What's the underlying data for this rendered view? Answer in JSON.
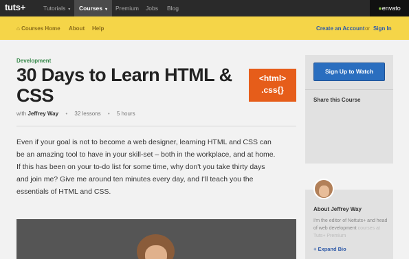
{
  "topnav": {
    "logo": "tuts+",
    "items": [
      {
        "label": "Tutorials",
        "caret": "▾"
      },
      {
        "label": "Courses",
        "caret": "▾"
      },
      {
        "label": "Premium"
      },
      {
        "label": "Jobs"
      },
      {
        "label": "Blog"
      }
    ],
    "brand": "envato"
  },
  "subbar": {
    "home": "Courses Home",
    "about": "About",
    "help": "Help",
    "create_account": "Create an Account",
    "or": "or",
    "sign_in": "Sign In"
  },
  "course": {
    "category": "Development",
    "title": "30 Days to Learn HTML & CSS",
    "with": "with",
    "author": "Jeffrey Way",
    "lessons": "32 lessons",
    "duration": "5 hours",
    "badge_line1": "<html>",
    "badge_line2": ".css{}",
    "description": "Even if your goal is not to become a web designer, learning HTML and CSS can be an amazing tool to have in your skill-set – both in the workplace, and at home. If this has been on your to-do list for some time, why don't you take thirty days and join me? Give me around ten minutes every day, and I'll teach you the essentials of HTML and CSS."
  },
  "sidebar": {
    "signup": "Sign Up to Watch",
    "share": "Share this Course",
    "author_title": "About Jeffrey Way",
    "author_bio_visible": "I'm the editor of Nettuts+ and head of web development",
    "author_bio_faded": "courses at Tuts+ Premium",
    "expand_bio": "+ Expand Bio"
  },
  "colors": {
    "nav_bg": "#2a2a2a",
    "subbar_bg": "#f5d548",
    "accent_blue": "#2a6ebf",
    "category_green": "#3a8a4d",
    "badge_orange": "#e65d1a"
  }
}
